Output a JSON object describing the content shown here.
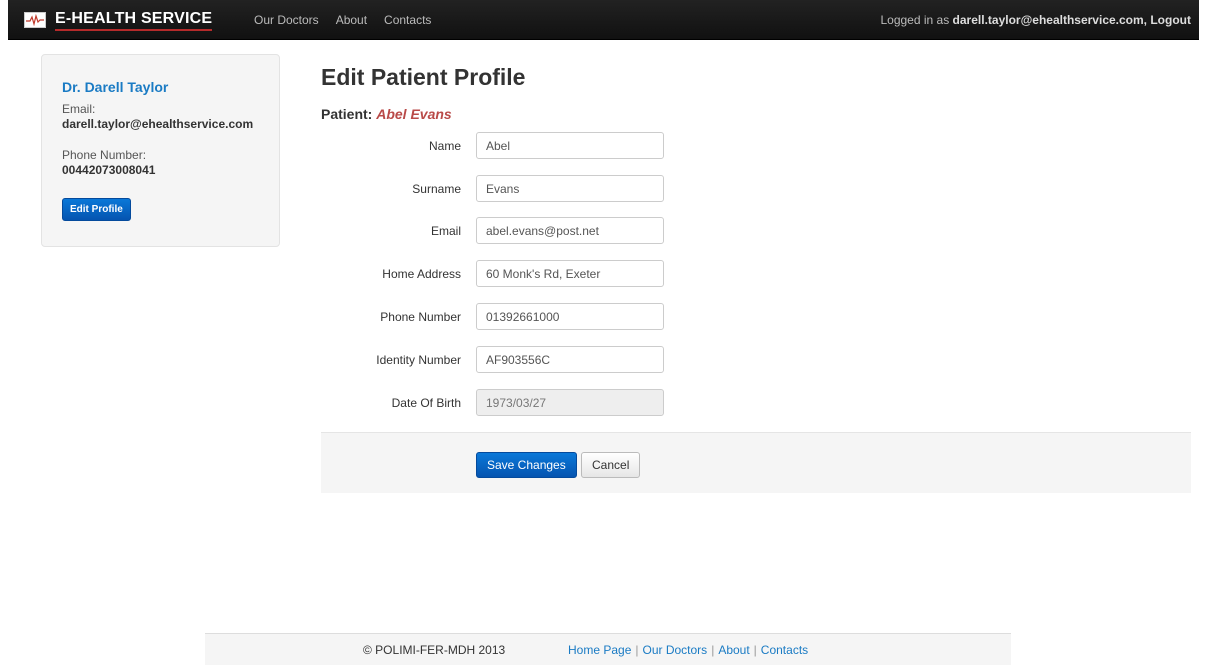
{
  "navbar": {
    "brand": "E-HEALTH SERVICE",
    "links": [
      "Our Doctors",
      "About",
      "Contacts"
    ],
    "logged_in_prefix": "Logged in as ",
    "user_email": "darell.taylor@ehealthservice.com",
    "logout": ", Logout"
  },
  "sidebar": {
    "doctor_name": "Dr. Darell Taylor",
    "email_label": "Email:",
    "email_value": "darell.taylor@ehealthservice.com",
    "phone_label": "Phone Number:",
    "phone_value": "00442073008041",
    "edit_button": "Edit Profile"
  },
  "main": {
    "title": "Edit Patient Profile",
    "patient_label": "Patient: ",
    "patient_name": "Abel Evans",
    "fields": [
      {
        "label": "Name",
        "value": "Abel"
      },
      {
        "label": "Surname",
        "value": "Evans"
      },
      {
        "label": "Email",
        "value": "abel.evans@post.net"
      },
      {
        "label": "Home Address",
        "value": "60 Monk's Rd, Exeter"
      },
      {
        "label": "Phone Number",
        "value": "01392661000"
      },
      {
        "label": "Identity Number",
        "value": "AF903556C"
      },
      {
        "label": "Date Of Birth",
        "value": "1973/03/27"
      }
    ],
    "save_button": "Save Changes",
    "cancel_button": "Cancel"
  },
  "footer": {
    "copyright": "© POLIMI-FER-MDH 2013",
    "links": [
      "Home Page",
      "Our Doctors",
      "About",
      "Contacts"
    ]
  },
  "colors": {
    "navbar_bg": "#1b1b1b",
    "accent_blue": "#1a7bc4",
    "patient_name": "#b94a48",
    "primary_button": "#0a6ccf"
  }
}
